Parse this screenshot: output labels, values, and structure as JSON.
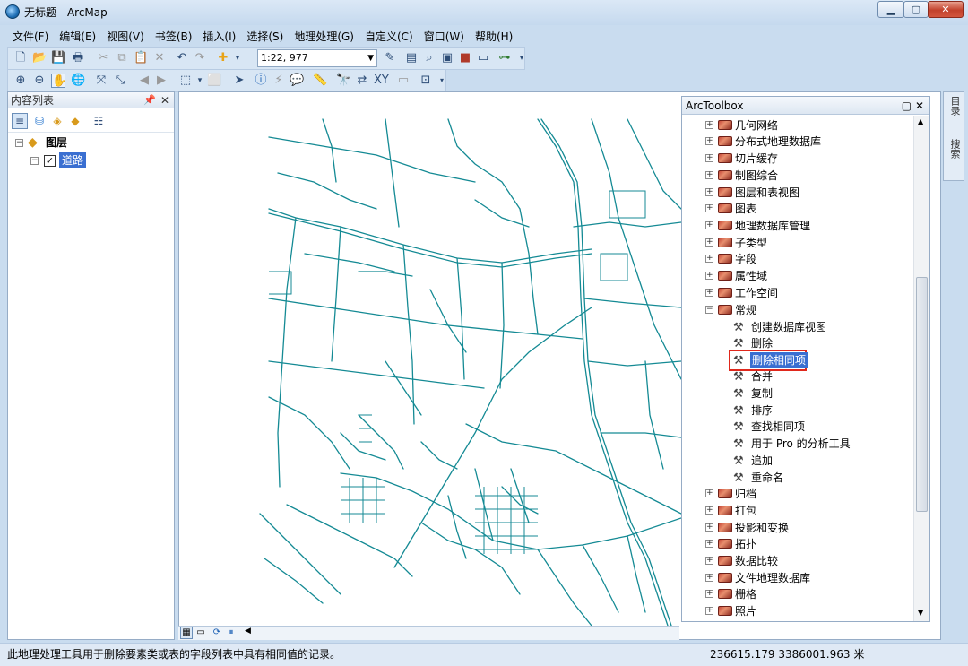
{
  "window": {
    "title": "无标题 - ArcMap",
    "minimize": "▁",
    "maximize": "▢",
    "close": "✕"
  },
  "menu": [
    "文件(F)",
    "编辑(E)",
    "视图(V)",
    "书签(B)",
    "插入(I)",
    "选择(S)",
    "地理处理(G)",
    "自定义(C)",
    "窗口(W)",
    "帮助(H)"
  ],
  "toolbar": {
    "scale": "1:22, 977"
  },
  "toc": {
    "title": "内容列表",
    "root_label": "图层",
    "layer_label": "道路"
  },
  "toolbox": {
    "title": "ArcToolbox",
    "top_items": [
      "几何网络",
      "分布式地理数据库",
      "切片缓存",
      "制图综合",
      "图层和表视图",
      "图表",
      "地理数据库管理",
      "子类型",
      "字段",
      "属性域",
      "工作空间",
      "常规"
    ],
    "general_tools": [
      "创建数据库视图",
      "删除",
      "删除相同项",
      "合并",
      "复制",
      "排序",
      "查找相同项",
      "用于 Pro 的分析工具",
      "追加",
      "重命名"
    ],
    "highlighted_tool": "删除相同项",
    "bottom_items": [
      "归档",
      "打包",
      "投影和变换",
      "拓扑",
      "数据比较",
      "文件地理数据库",
      "栅格",
      "照片"
    ]
  },
  "side_tabs": [
    "目录",
    "搜索"
  ],
  "status": {
    "message": "此地理处理工具用于删除要素类或表的字段列表中具有相同值的记录。",
    "coords": "236615.179  3386001.963 米"
  },
  "colors": {
    "road": "#148a94",
    "highlight": "#e0281c",
    "selection": "#3a6fd1"
  }
}
